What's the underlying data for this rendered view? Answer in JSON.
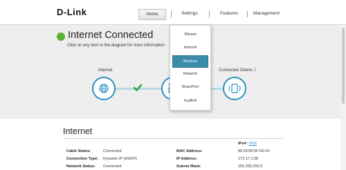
{
  "brand": {
    "logo_text": "D-Link"
  },
  "nav": {
    "items": [
      "Home",
      "Settings",
      "Features",
      "Management"
    ],
    "active": "Home"
  },
  "settings_menu": {
    "items": [
      "Wizard",
      "Internet",
      "Wireless",
      "Network",
      "SharePort",
      "mydlink"
    ],
    "selected": "Wireless"
  },
  "status": {
    "title": "Internet Connected",
    "subtitle": "Click on any item in the diagram for more information.",
    "indicator_color": "#59b132"
  },
  "diagram": {
    "internet_label": "Internet",
    "clients_label": "Connected Clients",
    "clients_count": "2",
    "icons": [
      "globe-icon",
      "check-icon",
      "router-icon",
      "tablet-icon"
    ]
  },
  "internet_section": {
    "title": "Internet",
    "tab_ipv4": "IPv4",
    "tab_separator": "/",
    "tab_ipv6": "IPv6",
    "left_rows": [
      {
        "label": "Cable Status:",
        "value": "Connected"
      },
      {
        "label": "Connection Type:",
        "value": "Dynamic IP (DHCP)"
      },
      {
        "label": "Network Status:",
        "value": "Connected"
      }
    ],
    "right_rows": [
      {
        "label": "MAC Address:",
        "value": "80:26:89:5F:FE:F6"
      },
      {
        "label": "IP Address:",
        "value": "172.17.2.98"
      },
      {
        "label": "Subnet Mask:",
        "value": "255.255.255.0"
      }
    ]
  },
  "colors": {
    "accent": "#2b8fbf",
    "menu_selected": "#3b8bab",
    "band": "#eeeeee"
  }
}
